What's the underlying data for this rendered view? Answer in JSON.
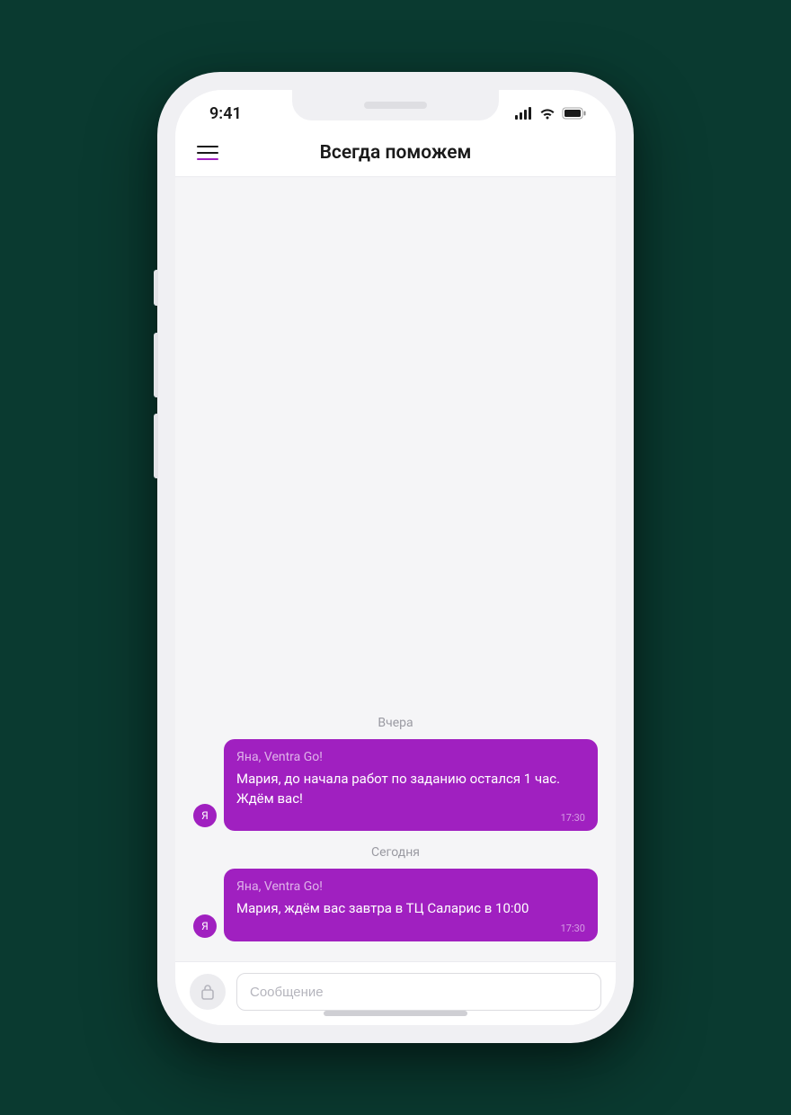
{
  "status": {
    "time": "9:41"
  },
  "header": {
    "title": "Всегда поможем"
  },
  "chat": {
    "groups": [
      {
        "label": "Вчера",
        "messages": [
          {
            "avatar": "Я",
            "sender": "Яна, Ventra Go!",
            "text": "Мария, до начала работ по заданию остался 1 час. Ждём вас!",
            "time": "17:30"
          }
        ]
      },
      {
        "label": "Сегодня",
        "messages": [
          {
            "avatar": "Я",
            "sender": "Яна, Ventra Go!",
            "text": "Мария, ждём вас завтра в ТЦ Саларис в 10:00",
            "time": "17:30"
          }
        ]
      }
    ]
  },
  "input": {
    "placeholder": "Сообщение"
  },
  "colors": {
    "accent": "#a020c0"
  }
}
